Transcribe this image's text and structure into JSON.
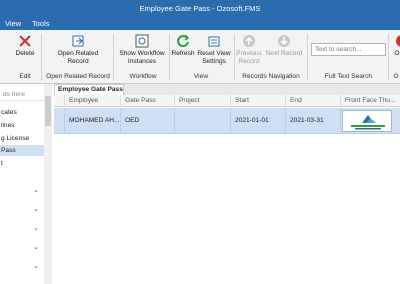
{
  "window": {
    "title": "Employee Gate Pass - Ozosoft.FMS"
  },
  "menu": {
    "view": "View",
    "tools": "Tools"
  },
  "ribbon": {
    "delete": "Delete",
    "open_related_record": "Open Related Record",
    "show_workflow_instances": "Show Workflow Instances",
    "refresh": "Refresh",
    "reset_view_settings": "Reset View Settings",
    "previous_record": "Previous Record",
    "next_record": "Next Record",
    "search_placeholder": "Text to search...",
    "groups": {
      "edit": "Edit",
      "open_related_record": "Open Related Record",
      "workflow": "Workflow",
      "view": "View",
      "records_navigation": "Records Navigation",
      "full_text_search": "Full Text Search"
    },
    "partial_right_button": "O",
    "partial_right_group": "O"
  },
  "nav": {
    "search_placeholder": "ds here",
    "items": [
      "cates",
      "lines",
      "g License",
      "Pass",
      "t"
    ]
  },
  "tab": {
    "label": "Employee Gate Pass"
  },
  "grid": {
    "columns": [
      "Employee",
      "Gate Pass",
      "Project",
      "Start",
      "End",
      "Front Face Thu..."
    ],
    "rows": [
      {
        "employee": "MOHAMED AH...",
        "gate_pass": "OED",
        "project": "",
        "start": "2021-01-01",
        "end": "2021-03-31"
      }
    ]
  },
  "colors": {
    "titlebar": "#2b6cae",
    "selection": "#cfe0f5",
    "delete_icon": "#d0312d",
    "refresh_icon": "#2e9e3e"
  }
}
